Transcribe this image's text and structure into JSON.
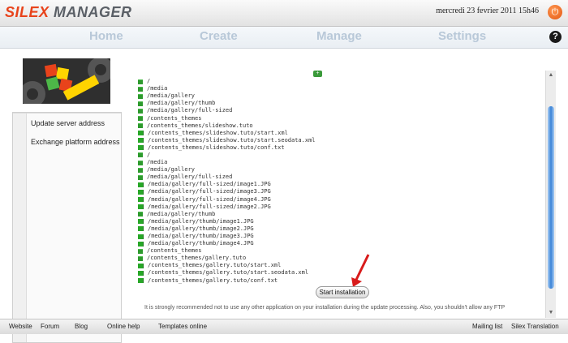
{
  "app": {
    "logo_part1": "SILEX",
    "logo_part2": "MANAGER"
  },
  "header": {
    "datetime": "mercredi 23 fevrier 2011 15h46"
  },
  "nav": {
    "home": "Home",
    "create": "Create",
    "manage": "Manage",
    "settings": "Settings"
  },
  "sidebar": {
    "items": [
      "Update server address",
      "Exchange platform address"
    ]
  },
  "files": [
    {
      "type": "folder",
      "path": "/"
    },
    {
      "type": "folder",
      "path": "/media"
    },
    {
      "type": "folder",
      "path": "/media/gallery"
    },
    {
      "type": "folder",
      "path": "/media/gallery/thumb"
    },
    {
      "type": "folder",
      "path": "/media/gallery/full-sized"
    },
    {
      "type": "folder",
      "path": "/contents_themes"
    },
    {
      "type": "folder",
      "path": "/contents_themes/slideshow.tuto"
    },
    {
      "type": "file",
      "path": "/contents_themes/slideshow.tuto/start.xml"
    },
    {
      "type": "file",
      "path": "/contents_themes/slideshow.tuto/start.seodata.xml"
    },
    {
      "type": "file",
      "path": "/contents_themes/slideshow.tuto/conf.txt"
    },
    {
      "type": "folder",
      "path": "/"
    },
    {
      "type": "folder",
      "path": "/media"
    },
    {
      "type": "folder",
      "path": "/media/gallery"
    },
    {
      "type": "folder",
      "path": "/media/gallery/full-sized"
    },
    {
      "type": "file",
      "path": "/media/gallery/full-sized/image1.JPG"
    },
    {
      "type": "file",
      "path": "/media/gallery/full-sized/image3.JPG"
    },
    {
      "type": "file",
      "path": "/media/gallery/full-sized/image4.JPG"
    },
    {
      "type": "file",
      "path": "/media/gallery/full-sized/image2.JPG"
    },
    {
      "type": "folder",
      "path": "/media/gallery/thumb"
    },
    {
      "type": "file",
      "path": "/media/gallery/thumb/image1.JPG"
    },
    {
      "type": "file",
      "path": "/media/gallery/thumb/image2.JPG"
    },
    {
      "type": "file",
      "path": "/media/gallery/thumb/image3.JPG"
    },
    {
      "type": "file",
      "path": "/media/gallery/thumb/image4.JPG"
    },
    {
      "type": "folder",
      "path": "/contents_themes"
    },
    {
      "type": "folder",
      "path": "/contents_themes/gallery.tuto"
    },
    {
      "type": "file",
      "path": "/contents_themes/gallery.tuto/start.xml"
    },
    {
      "type": "file",
      "path": "/contents_themes/gallery.tuto/start.seodata.xml"
    },
    {
      "type": "file",
      "path": "/contents_themes/gallery.tuto/conf.txt"
    }
  ],
  "install": {
    "button_label": "Start installation"
  },
  "notice": "It is strongly recommended not to use any other application on your installation during the update processing. Also, you shouldn't allow any FTP",
  "footer": {
    "links_left": [
      "Website",
      "Forum",
      "Blog",
      "Online help",
      "Templates online"
    ],
    "links_right": [
      "Mailing list",
      "Silex Translation"
    ]
  },
  "colors": {
    "accent": "#e8431b",
    "nav_text": "#b8c8d8",
    "file_icon": "#2e9a2e",
    "scroll_thumb": "#3a82d6",
    "arrow": "#d81b1b"
  },
  "icons": {
    "power": "power-icon",
    "help": "help-icon",
    "folder": "folder-icon",
    "file": "file-icon",
    "arrow": "red-arrow-icon"
  }
}
